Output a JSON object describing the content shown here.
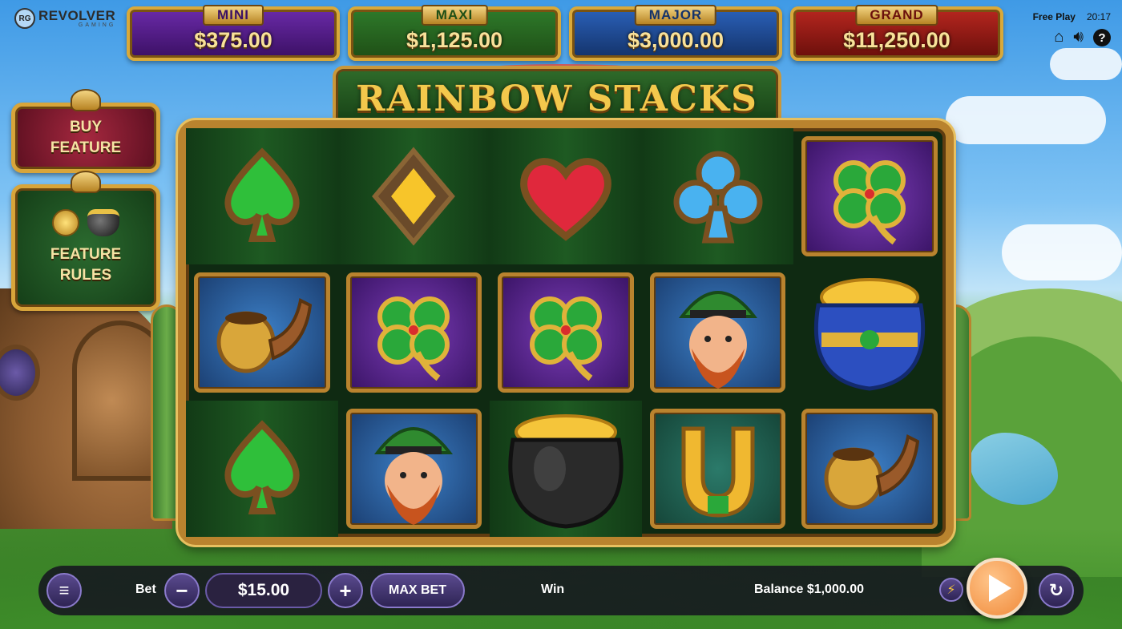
{
  "brand": {
    "initials": "RG",
    "name": "REVOLVER",
    "sub": "GAMING"
  },
  "jackpots": [
    {
      "label": "MINI",
      "value": "$375.00",
      "color": "#6a2aa8",
      "label_color": "#3b1064"
    },
    {
      "label": "MAXI",
      "value": "$1,125.00",
      "color": "#2e7a2a",
      "label_color": "#1f4f16"
    },
    {
      "label": "MAJOR",
      "value": "$3,000.00",
      "color": "#2a60b8",
      "label_color": "#14336a"
    },
    {
      "label": "GRAND",
      "value": "$11,250.00",
      "color": "#b6261f",
      "label_color": "#6a0f0b"
    }
  ],
  "status": {
    "mode": "Free Play",
    "time": "20:17"
  },
  "icons": {
    "home": "home-icon",
    "sound": "speaker-icon",
    "help": "help-icon",
    "menu": "menu-icon",
    "turbo": "lightning-icon",
    "autoplay": "autoplay-icon",
    "spin": "play-icon"
  },
  "title": "RAINBOW STACKS",
  "side": {
    "buy_feature": "BUY FEATURE",
    "feature_rules": "FEATURE RULES"
  },
  "reels": [
    [
      "spade",
      "pipe",
      "spade"
    ],
    [
      "diamond",
      "clover",
      "leprechaun"
    ],
    [
      "heart",
      "clover",
      "black-pot"
    ],
    [
      "club",
      "leprechaun",
      "horseshoe"
    ],
    [
      "clover",
      "blue-pot",
      "pipe"
    ]
  ],
  "bar": {
    "bet_label": "Bet",
    "bet_value": "$15.00",
    "minus": "−",
    "plus": "+",
    "max_bet": "MAX BET",
    "win_label": "Win",
    "balance": "Balance $1,000.00"
  }
}
